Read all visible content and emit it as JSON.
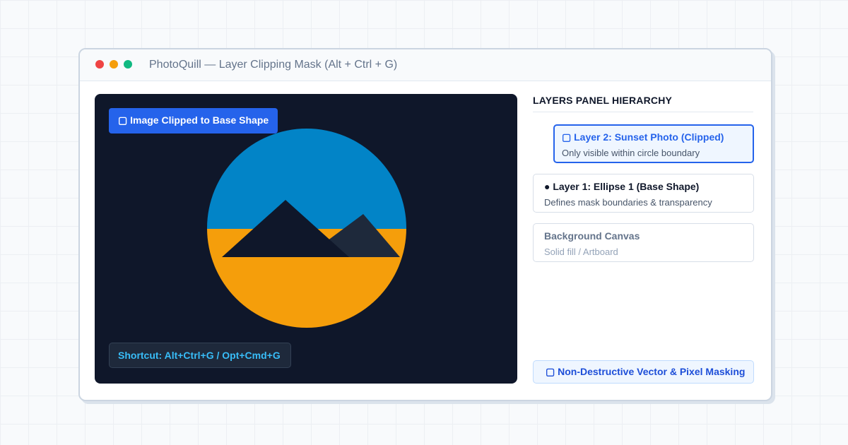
{
  "window": {
    "title": "PhotoQuill — Layer Clipping Mask (Alt + Ctrl + G)"
  },
  "canvas": {
    "clip_badge": "▢ Image Clipped to Base Shape",
    "shortcut_badge": "Shortcut: Alt+Ctrl+G / Opt+Cmd+G",
    "colors": {
      "background": "#0f172a",
      "sky": "#0284c7",
      "ground": "#f59e0b",
      "mountain_front": "#0f172a",
      "mountain_back": "#1e293b"
    }
  },
  "layers_panel": {
    "title": "LAYERS PANEL HIERARCHY",
    "layers": [
      {
        "name": "▢ Layer 2: Sunset Photo (Clipped)",
        "description": "Only visible within circle boundary"
      },
      {
        "name": "● Layer 1: Ellipse 1 (Base Shape)",
        "description": "Defines mask boundaries & transparency"
      },
      {
        "name": "Background Canvas",
        "description": "Solid fill / Artboard"
      }
    ],
    "footer": "▢ Non-Destructive Vector & Pixel Masking"
  },
  "colors": {
    "accent": "#2563eb",
    "shortcut_text": "#38bdf8"
  }
}
